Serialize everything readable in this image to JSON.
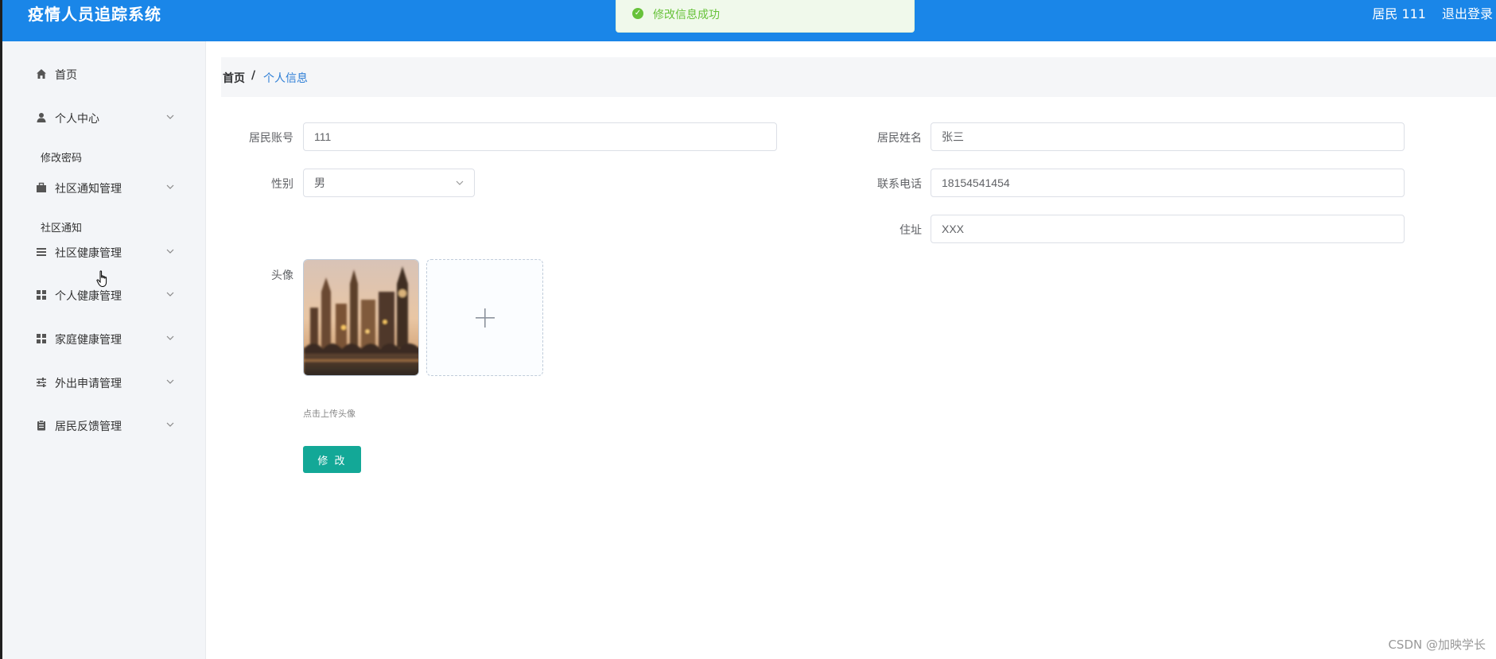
{
  "header": {
    "title": "疫情人员追踪系统",
    "user": "居民 111",
    "logout": "退出登录",
    "color": "#1a86e8"
  },
  "toast": {
    "message": "修改信息成功",
    "icon": "check-circle-icon",
    "color": "#67c23a"
  },
  "sidebar": {
    "items": [
      {
        "label": "首页",
        "icon": "home-icon"
      },
      {
        "label": "个人中心",
        "icon": "user-icon"
      },
      {
        "label": "修改密码",
        "icon": ""
      },
      {
        "label": "社区通知管理",
        "icon": "briefcase-icon"
      },
      {
        "label": "社区通知",
        "icon": ""
      },
      {
        "label": "社区健康管理",
        "icon": "list-icon"
      },
      {
        "label": "个人健康管理",
        "icon": "grid-icon"
      },
      {
        "label": "家庭健康管理",
        "icon": "grid-icon"
      },
      {
        "label": "外出申请管理",
        "icon": "sliders-icon"
      },
      {
        "label": "居民反馈管理",
        "icon": "clipboard-icon"
      }
    ]
  },
  "breadcrumb": {
    "home": "首页",
    "separator": "/",
    "current": "个人信息"
  },
  "form": {
    "account_label": "居民账号",
    "account_value": "111",
    "name_label": "居民姓名",
    "name_value": "张三",
    "gender_label": "性别",
    "gender_value": "男",
    "phone_label": "联系电话",
    "phone_value": "18154541454",
    "address_label": "住址",
    "address_value": "XXX",
    "avatar_label": "头像",
    "upload_hint": "点击上传头像",
    "submit_label": "修 改",
    "submit_color": "#13a897"
  },
  "watermark": "CSDN @加映学长"
}
